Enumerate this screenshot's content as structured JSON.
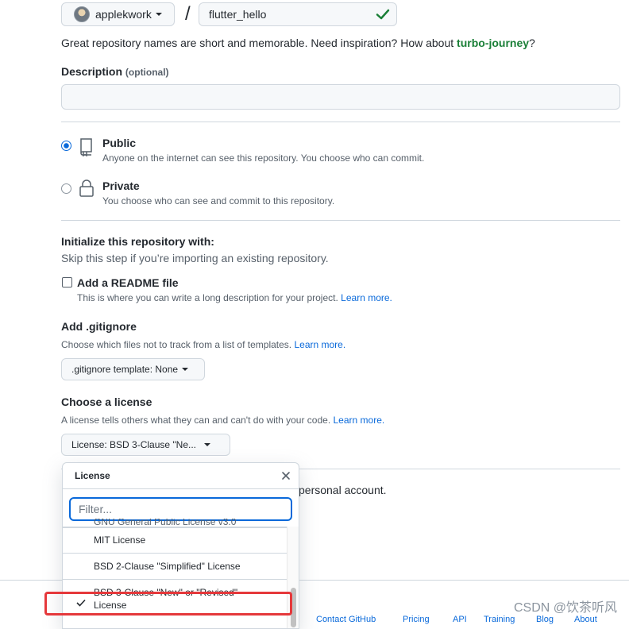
{
  "repo": {
    "owner": "applekwork",
    "separator": "/",
    "name": "flutter_hello",
    "name_hint_prefix": "Great repository names are short and memorable. Need inspiration? How about ",
    "name_hint_suggestion": "turbo-journey",
    "name_hint_suffix": "?"
  },
  "description": {
    "label": "Description",
    "optional": "(optional)",
    "value": ""
  },
  "visibility": {
    "public_title": "Public",
    "public_sub": "Anyone on the internet can see this repository. You choose who can commit.",
    "private_title": "Private",
    "private_sub": "You choose who can see and commit to this repository.",
    "selected": "public"
  },
  "init": {
    "title": "Initialize this repository with:",
    "subtitle": "Skip this step if you’re importing an existing repository.",
    "readme_label": "Add a README file",
    "readme_sub": "This is where you can write a long description for your project.",
    "learn_more": "Learn more."
  },
  "gitignore": {
    "title": "Add .gitignore",
    "subtitle": "Choose which files not to track from a list of templates.",
    "learn_more": "Learn more.",
    "button": ".gitignore template: None"
  },
  "license": {
    "title": "Choose a license",
    "subtitle": "A license tells others what they can and can't do with your code.",
    "learn_more": "Learn more.",
    "button": "License: BSD 3-Clause \"Ne..."
  },
  "behind_menu_text": "personal account.",
  "license_menu": {
    "header": "License",
    "filter_placeholder": "Filter...",
    "items": [
      "GNU General Public License v3.0",
      "MIT License",
      "BSD 2-Clause \"Simplified\" License",
      "BSD 3-Clause \"New\" or \"Revised\"",
      "License"
    ],
    "selected_index": 3
  },
  "footer_links": [
    "Contact GitHub",
    "Pricing",
    "API",
    "Training",
    "Blog",
    "About"
  ],
  "watermark": "CSDN @饮茶听风",
  "colors": {
    "accent": "#0969da",
    "success": "#1a7f37",
    "highlight": "#e5383b"
  }
}
